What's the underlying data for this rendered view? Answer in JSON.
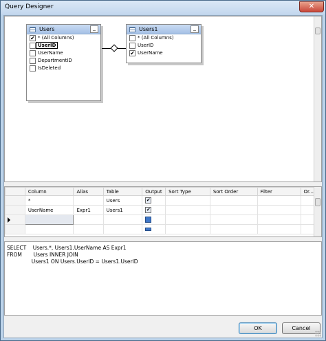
{
  "window": {
    "title": "Query Designer",
    "close_glyph": "✕"
  },
  "diagram": {
    "tables": [
      {
        "name": "Users",
        "columns": [
          {
            "label": "* (All Columns)",
            "checked": true
          },
          {
            "label": "UserID",
            "checked": false,
            "selected": true
          },
          {
            "label": "UserName",
            "checked": false
          },
          {
            "label": "DepartmentID",
            "checked": false
          },
          {
            "label": "IsDeleted",
            "checked": false
          }
        ]
      },
      {
        "name": "Users1",
        "columns": [
          {
            "label": "* (All Columns)",
            "checked": false
          },
          {
            "label": "UserID",
            "checked": false
          },
          {
            "label": "UserName",
            "checked": true
          }
        ]
      }
    ],
    "minimize_glyph": "_",
    "check_glyph": "✔"
  },
  "grid": {
    "headers": [
      "Column",
      "Alias",
      "Table",
      "Output",
      "Sort Type",
      "Sort Order",
      "Filter",
      "Or..."
    ],
    "rows": [
      {
        "column": "*",
        "alias": "",
        "table": "Users",
        "output": true
      },
      {
        "column": "UserName",
        "alias": "Expr1",
        "table": "Users1",
        "output": true
      }
    ]
  },
  "sql": {
    "lines": [
      "SELECT    Users.*, Users1.UserName AS Expr1",
      "FROM       Users INNER JOIN",
      "               Users1 ON Users.UserID = Users1.UserID"
    ]
  },
  "buttons": {
    "ok": "OK",
    "cancel": "Cancel"
  }
}
